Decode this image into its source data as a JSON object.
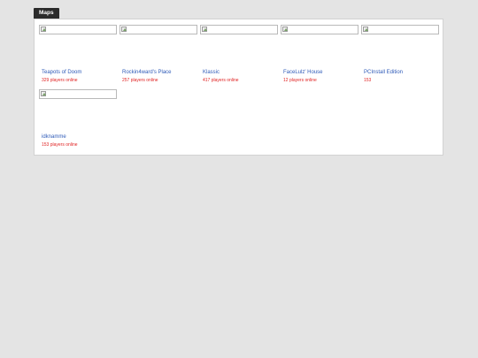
{
  "tab": {
    "label": "Maps"
  },
  "maps": [
    {
      "name": "Teapots of Doom",
      "players": "329 players online"
    },
    {
      "name": "Rockin4ward's Place",
      "players": "257 players online"
    },
    {
      "name": "Klassic",
      "players": "417 players online"
    },
    {
      "name": "FaceLulz' House",
      "players": "12 players online"
    },
    {
      "name": "PCInstall Edition",
      "players": "153"
    },
    {
      "name": "idknamme",
      "players": "153 players online"
    }
  ]
}
